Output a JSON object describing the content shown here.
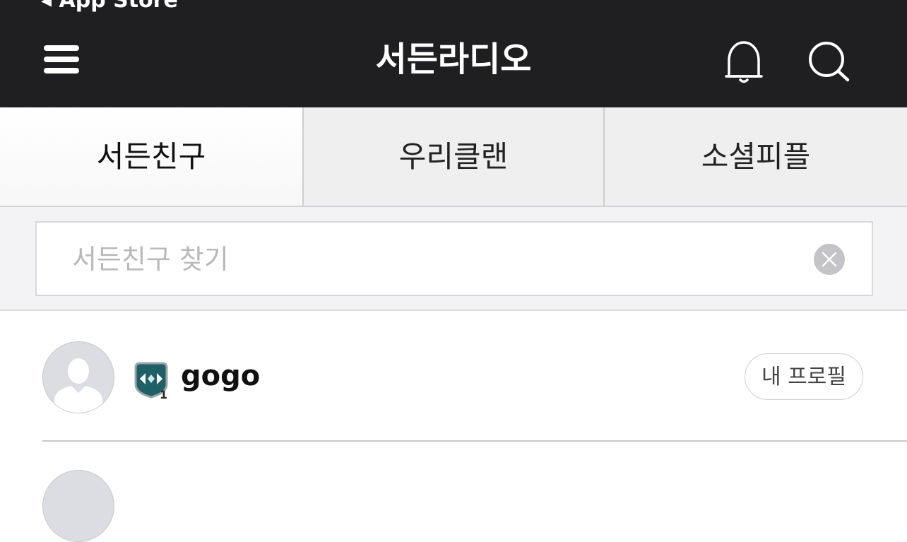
{
  "statusbar": {
    "back_label": "◂ App Store"
  },
  "header": {
    "title": "서든라디오",
    "menu_icon": "hamburger-menu-icon",
    "bell_icon": "bell-icon",
    "search_icon": "search-icon"
  },
  "tabs": [
    {
      "label": "서든친구",
      "active": true
    },
    {
      "label": "우리클랜",
      "active": false
    },
    {
      "label": "소셜피플",
      "active": false
    }
  ],
  "search": {
    "placeholder": "서든친구 찾기",
    "value": "",
    "clear_icon": "clear-x-icon"
  },
  "friends": [
    {
      "name": "gogo",
      "avatar_icon": "default-avatar-icon",
      "rank_icon": "rank-badge-icon",
      "rank_number": "1",
      "action_label": "내 프로필"
    }
  ],
  "colors": {
    "header_bg": "#1f1f22",
    "tab_bg": "#efeff0",
    "search_area_bg": "#f3f3f5",
    "clear_btn": "#c4c4c8",
    "rank_badge": "#1f5f66"
  }
}
